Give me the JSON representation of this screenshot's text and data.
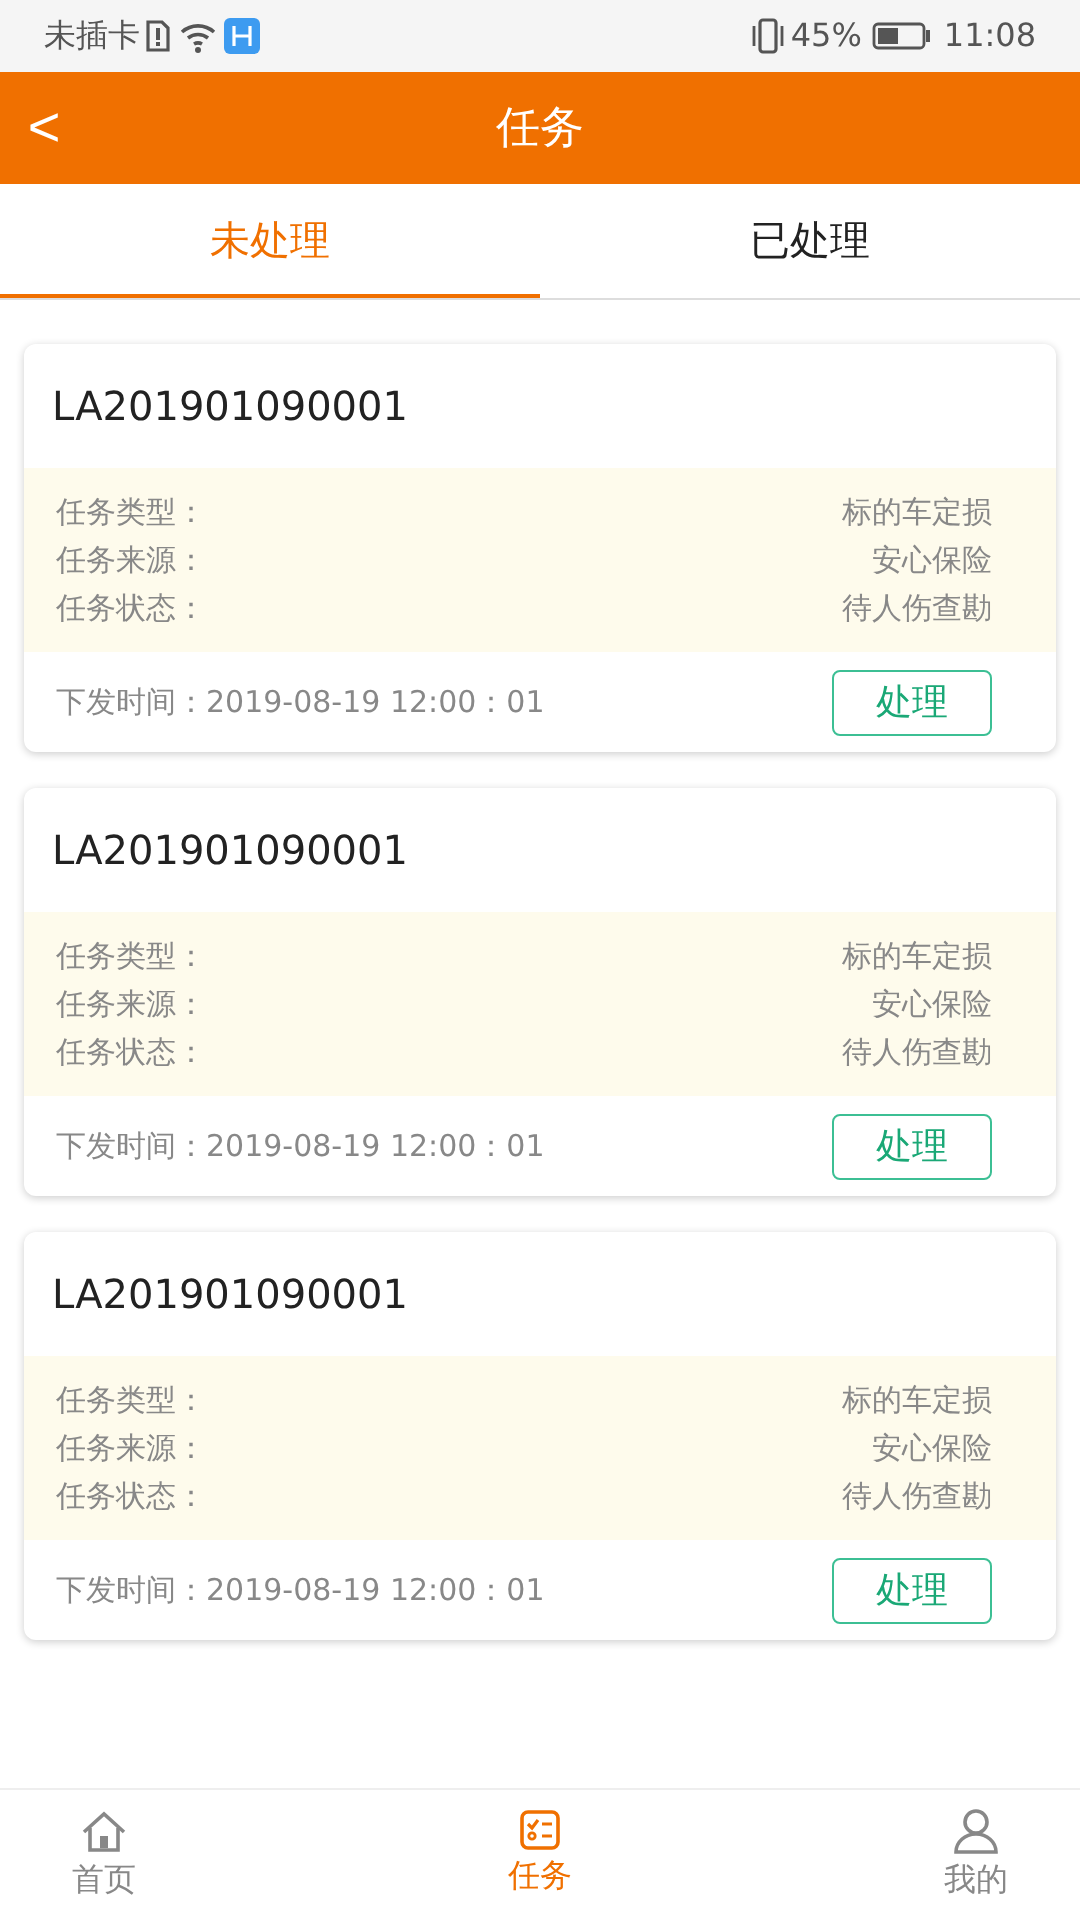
{
  "status_bar": {
    "carrier": "未插卡",
    "battery": "45%",
    "time": "11:08"
  },
  "header": {
    "title": "任务",
    "back": "<"
  },
  "tabs": [
    {
      "label": "未处理",
      "selected": true
    },
    {
      "label": "已处理",
      "selected": false
    }
  ],
  "tasks": [
    {
      "id": "LA201901090001",
      "fields": [
        {
          "label": "任务类型：",
          "value": "标的车定损"
        },
        {
          "label": "任务来源：",
          "value": "安心保险"
        },
        {
          "label": "任务状态：",
          "value": "待人伤查勘"
        }
      ],
      "issued": "下发时间：2019-08-19 12:00：01",
      "action": "处理"
    },
    {
      "id": "LA201901090001",
      "fields": [
        {
          "label": "任务类型：",
          "value": "标的车定损"
        },
        {
          "label": "任务来源：",
          "value": "安心保险"
        },
        {
          "label": "任务状态：",
          "value": "待人伤查勘"
        }
      ],
      "issued": "下发时间：2019-08-19 12:00：01",
      "action": "处理"
    },
    {
      "id": "LA201901090001",
      "fields": [
        {
          "label": "任务类型：",
          "value": "标的车定损"
        },
        {
          "label": "任务来源：",
          "value": "安心保险"
        },
        {
          "label": "任务状态：",
          "value": "待人伤查勘"
        }
      ],
      "issued": "下发时间：2019-08-19 12:00：01",
      "action": "处理"
    }
  ],
  "nav": [
    {
      "kind": "home",
      "label": "首页",
      "selected": false
    },
    {
      "kind": "tasks",
      "label": "任务",
      "selected": true
    },
    {
      "kind": "profile",
      "label": "我的",
      "selected": false
    }
  ]
}
